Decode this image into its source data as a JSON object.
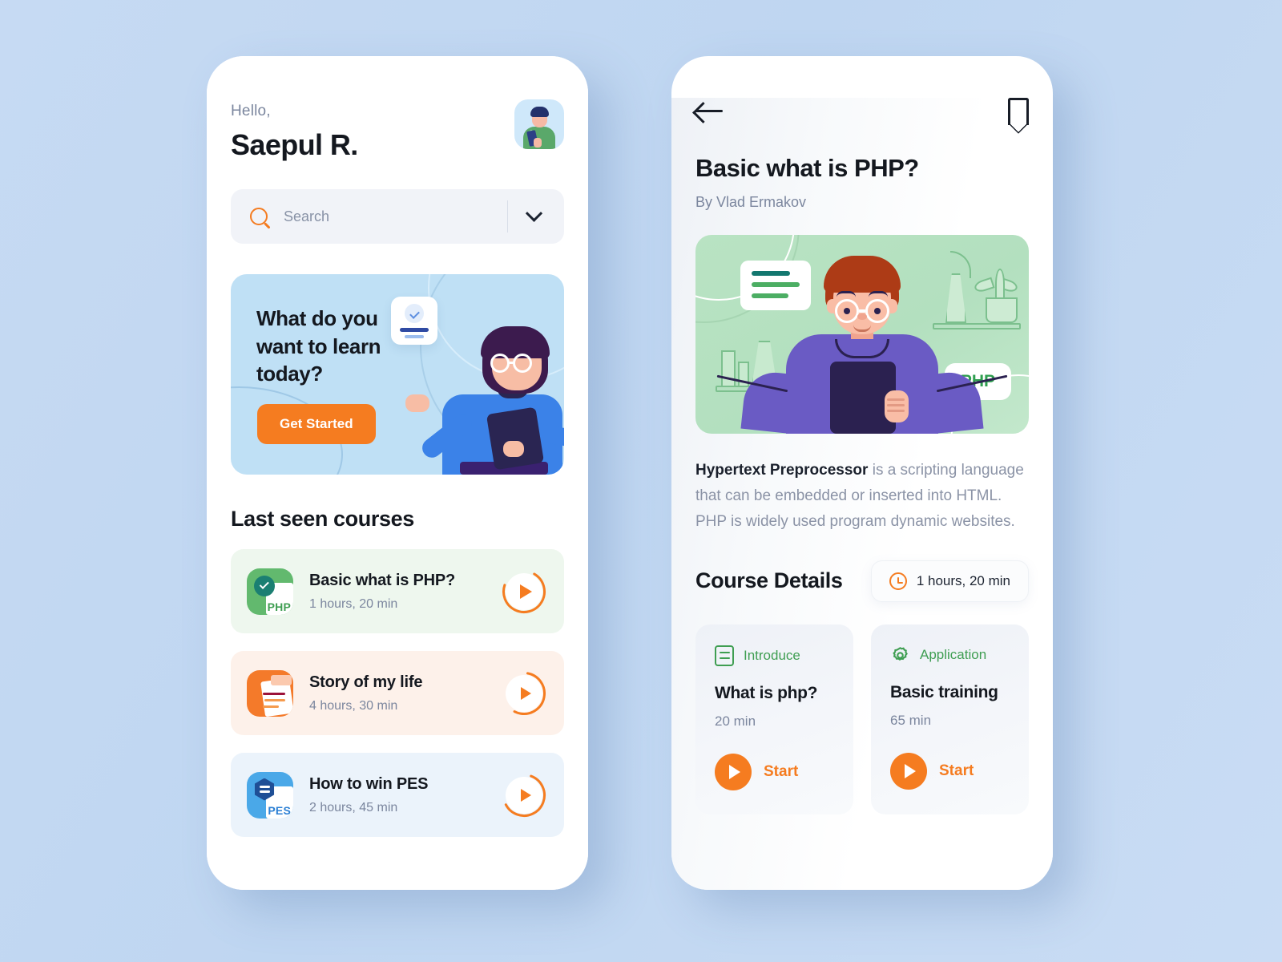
{
  "home": {
    "greeting": "Hello,",
    "user_name": "Saepul R.",
    "avatar_alt": "user-avatar",
    "search": {
      "placeholder": "Search",
      "icon": "search-icon",
      "chevron": "chevron-down-icon"
    },
    "banner": {
      "title": "What do you want to learn today?",
      "cta": "Get Started",
      "accent": "#f57c20",
      "background": "#bfe0f5"
    },
    "section_title": "Last seen courses",
    "courses": [
      {
        "name": "Basic what is PHP?",
        "duration": "1 hours, 20 min",
        "abbr": "PHP",
        "card_bg": "#eef7ee",
        "icon_bg": "#62b96e",
        "abbr_color": "#3f9e52",
        "badge": "check-badge",
        "badge_bg": "#1b7f72",
        "progress": 0.72
      },
      {
        "name": "Story of my life",
        "duration": "4 hours, 30 min",
        "abbr": "",
        "card_bg": "#fdf1ea",
        "icon_bg": "#f47a2a",
        "abbr_color": "#f47a2a",
        "badge": "",
        "badge_bg": "",
        "progress": 0.55
      },
      {
        "name": "How to win PES",
        "duration": "2 hours, 45 min",
        "abbr": "PES",
        "card_bg": "#ebf3fb",
        "icon_bg": "#4aa8e8",
        "abbr_color": "#2b7fd4",
        "badge": "hex-badge",
        "badge_bg": "#1f4f96",
        "progress": 0.62
      }
    ]
  },
  "detail": {
    "back_icon": "arrow-left-icon",
    "bookmark_icon": "bookmark-icon",
    "title": "Basic what is PHP?",
    "author": "By Vlad Ermakov",
    "hero": {
      "badge": "PHP",
      "background": "#b6e1c1"
    },
    "description_bold": "Hypertext Preprocessor",
    "description_rest": " is a scripting language that can be embedded or inserted into HTML. PHP is widely used program dynamic websites.",
    "details_title": "Course Details",
    "duration_badge": {
      "icon": "clock-icon",
      "text": "1 hours, 20 min"
    },
    "lessons": [
      {
        "category": "Introduce",
        "category_icon": "document-icon",
        "title": "What is php?",
        "duration": "20 min",
        "start_label": "Start"
      },
      {
        "category": "Application",
        "category_icon": "gear-icon",
        "title": "Basic training",
        "duration": "65 min",
        "start_label": "Start"
      }
    ]
  },
  "theme": {
    "orange": "#f57c20",
    "green": "#3f9e52",
    "page_bg": "#c3d8f2",
    "text_dark": "#14181f",
    "text_muted": "#7b869e"
  }
}
